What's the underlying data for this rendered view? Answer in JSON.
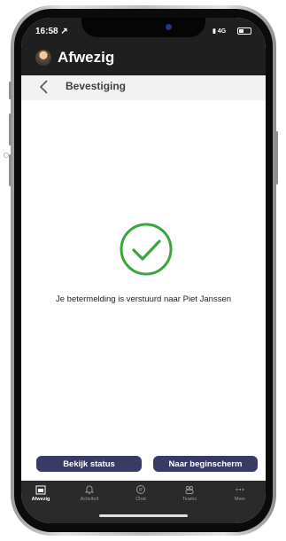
{
  "status_bar": {
    "time": "16:58 ↗",
    "network": "4G"
  },
  "header": {
    "title": "Afwezig"
  },
  "nav": {
    "title": "Bevestiging"
  },
  "confirmation": {
    "message": "Je betermelding is verstuurd naar Piet Janssen"
  },
  "actions": {
    "status_label": "Bekijk status",
    "home_label": "Naar beginscherm"
  },
  "tabs": [
    {
      "label": "Afwezig",
      "icon": "calendar-icon",
      "active": true
    },
    {
      "label": "Activiteit",
      "icon": "bell-icon",
      "active": false
    },
    {
      "label": "Chat",
      "icon": "chat-icon",
      "active": false
    },
    {
      "label": "Teams",
      "icon": "teams-icon",
      "active": false
    },
    {
      "label": "Meer",
      "icon": "more-icon",
      "active": false
    }
  ],
  "colors": {
    "success": "#3aa53a",
    "button": "#3a3a68",
    "header_bg": "#1f1f1f"
  }
}
